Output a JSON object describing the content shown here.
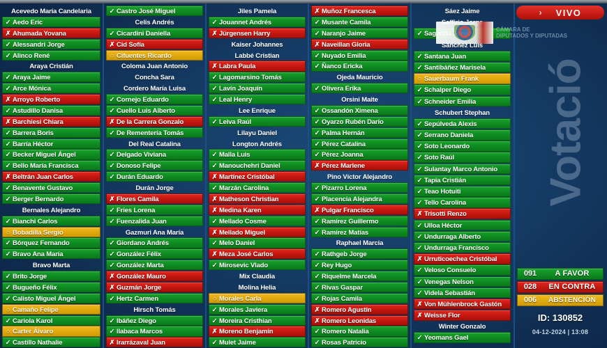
{
  "header": {
    "live_badge": {
      "chevron": "›",
      "label": "VIVO"
    },
    "logo_text_line1": "CÁMARA DE",
    "logo_text_line2": "DIPUTADOS Y DIPUTADAS"
  },
  "watermark": {
    "text": "Votació"
  },
  "results": {
    "favor": {
      "count": "091",
      "label": "A FAVOR",
      "color": "#0f8a21"
    },
    "contra": {
      "count": "028",
      "label": "EN CONTRA",
      "color": "#c41710"
    },
    "abstain": {
      "count": "006",
      "label": "ABSTENCIÓN",
      "color": "#e0a80c"
    }
  },
  "session": {
    "id_label": "ID: 130852",
    "datetime": "04-12-2024  |  13:08"
  },
  "marks": {
    "favor": "✓",
    "contra": "✗",
    "abstain": "○",
    "none": ""
  },
  "columns": [
    {
      "rows": [
        {
          "name": "Acevedo María Candelaria",
          "vote": "none"
        },
        {
          "name": "Aedo Eric",
          "vote": "favor"
        },
        {
          "name": "Ahumada Yovana",
          "vote": "contra"
        },
        {
          "name": "Alessandri Jorge",
          "vote": "favor"
        },
        {
          "name": "Alinco René",
          "vote": "favor"
        },
        {
          "name": "Araya Cristián",
          "vote": "none"
        },
        {
          "name": "Araya Jaime",
          "vote": "favor"
        },
        {
          "name": "Arce Mónica",
          "vote": "favor"
        },
        {
          "name": "Arroyo Roberto",
          "vote": "contra"
        },
        {
          "name": "Astudillo Danisa",
          "vote": "favor"
        },
        {
          "name": "Barchiesi Chiara",
          "vote": "contra"
        },
        {
          "name": "Barrera Boris",
          "vote": "favor"
        },
        {
          "name": "Barría Héctor",
          "vote": "favor"
        },
        {
          "name": "Becker Miguel Ángel",
          "vote": "favor"
        },
        {
          "name": "Bello María Francisca",
          "vote": "favor"
        },
        {
          "name": "Beltrán Juan Carlos",
          "vote": "contra"
        },
        {
          "name": "Benavente Gustavo",
          "vote": "favor"
        },
        {
          "name": "Berger Bernardo",
          "vote": "favor"
        },
        {
          "name": "Bernales Alejandro",
          "vote": "none"
        },
        {
          "name": "Bianchi Carlos",
          "vote": "favor"
        },
        {
          "name": "Bobadilla Sergio",
          "vote": "abstain"
        },
        {
          "name": "Bórquez Fernando",
          "vote": "favor"
        },
        {
          "name": "Bravo Ana María",
          "vote": "favor"
        },
        {
          "name": "Bravo Marta",
          "vote": "none"
        },
        {
          "name": "Brito Jorge",
          "vote": "favor"
        },
        {
          "name": "Bugueño Félix",
          "vote": "favor"
        },
        {
          "name": "Calisto Miguel Ángel",
          "vote": "favor"
        },
        {
          "name": "Camaño Felipe",
          "vote": "abstain"
        },
        {
          "name": "Cariola Karol",
          "vote": "favor"
        },
        {
          "name": "Carter Álvaro",
          "vote": "abstain"
        },
        {
          "name": "Castillo Nathalie",
          "vote": "favor"
        }
      ]
    },
    {
      "rows": [
        {
          "name": "Castro José Miguel",
          "vote": "favor"
        },
        {
          "name": "Celis Andrés",
          "vote": "none"
        },
        {
          "name": "Cicardini Daniella",
          "vote": "favor"
        },
        {
          "name": "Cid Sofía",
          "vote": "contra"
        },
        {
          "name": "Cifuentes Ricardo",
          "vote": "abstain"
        },
        {
          "name": "Coloma Juan Antonio",
          "vote": "none"
        },
        {
          "name": "Concha Sara",
          "vote": "none"
        },
        {
          "name": "Cordero María Luisa",
          "vote": "none"
        },
        {
          "name": "Cornejo Eduardo",
          "vote": "favor"
        },
        {
          "name": "Cuello Luis Alberto",
          "vote": "favor"
        },
        {
          "name": "De la Carrera Gonzalo",
          "vote": "contra"
        },
        {
          "name": "De Rementería Tomás",
          "vote": "favor"
        },
        {
          "name": "Del Real Catalina",
          "vote": "none"
        },
        {
          "name": "Delgado Viviana",
          "vote": "favor"
        },
        {
          "name": "Donoso Felipe",
          "vote": "favor"
        },
        {
          "name": "Durán Eduardo",
          "vote": "favor"
        },
        {
          "name": "Durán Jorge",
          "vote": "none"
        },
        {
          "name": "Flores Camila",
          "vote": "contra"
        },
        {
          "name": "Fries Lorena",
          "vote": "favor"
        },
        {
          "name": "Fuenzalida Juan",
          "vote": "favor"
        },
        {
          "name": "Gazmuri Ana María",
          "vote": "none"
        },
        {
          "name": "Giordano Andrés",
          "vote": "favor"
        },
        {
          "name": "González Félix",
          "vote": "favor"
        },
        {
          "name": "González Marta",
          "vote": "favor"
        },
        {
          "name": "González Mauro",
          "vote": "contra"
        },
        {
          "name": "Guzmán Jorge",
          "vote": "contra"
        },
        {
          "name": "Hertz Carmen",
          "vote": "favor"
        },
        {
          "name": "Hirsch Tomás",
          "vote": "none"
        },
        {
          "name": "Ibáñez Diego",
          "vote": "favor"
        },
        {
          "name": "Ilabaca Marcos",
          "vote": "favor"
        },
        {
          "name": "Irarrázaval Juan",
          "vote": "contra"
        }
      ]
    },
    {
      "rows": [
        {
          "name": "Jiles Pamela",
          "vote": "none"
        },
        {
          "name": "Jouannet Andrés",
          "vote": "favor"
        },
        {
          "name": "Jürgensen Harry",
          "vote": "contra"
        },
        {
          "name": "Kaiser Johannes",
          "vote": "none"
        },
        {
          "name": "Labbé Cristian",
          "vote": "none"
        },
        {
          "name": "Labra Paula",
          "vote": "contra"
        },
        {
          "name": "Lagomarsino Tomás",
          "vote": "favor"
        },
        {
          "name": "Lavín Joaquín",
          "vote": "favor"
        },
        {
          "name": "Leal Henry",
          "vote": "favor"
        },
        {
          "name": "Lee Enrique",
          "vote": "none"
        },
        {
          "name": "Leiva Raúl",
          "vote": "favor"
        },
        {
          "name": "Lilayu Daniel",
          "vote": "none"
        },
        {
          "name": "Longton Andrés",
          "vote": "none"
        },
        {
          "name": "Malla Luis",
          "vote": "favor"
        },
        {
          "name": "Manouchehri Daniel",
          "vote": "favor"
        },
        {
          "name": "Martínez Cristóbal",
          "vote": "contra"
        },
        {
          "name": "Marzán Carolina",
          "vote": "favor"
        },
        {
          "name": "Matheson Christian",
          "vote": "contra"
        },
        {
          "name": "Medina Karen",
          "vote": "contra"
        },
        {
          "name": "Mellado Cosme",
          "vote": "favor"
        },
        {
          "name": "Mellado Miguel",
          "vote": "contra"
        },
        {
          "name": "Melo Daniel",
          "vote": "favor"
        },
        {
          "name": "Meza José Carlos",
          "vote": "contra"
        },
        {
          "name": "Mirosevic Vlado",
          "vote": "favor"
        },
        {
          "name": "Mix Claudia",
          "vote": "none"
        },
        {
          "name": "Molina Helia",
          "vote": "none"
        },
        {
          "name": "Morales Carla",
          "vote": "abstain"
        },
        {
          "name": "Morales Javiera",
          "vote": "favor"
        },
        {
          "name": "Moreira Cristhian",
          "vote": "favor"
        },
        {
          "name": "Moreno Benjamín",
          "vote": "contra"
        },
        {
          "name": "Mulet Jaime",
          "vote": "favor"
        }
      ]
    },
    {
      "rows": [
        {
          "name": "Muñoz Francesca",
          "vote": "contra"
        },
        {
          "name": "Musante Camila",
          "vote": "favor"
        },
        {
          "name": "Naranjo Jaime",
          "vote": "favor"
        },
        {
          "name": "Naveillan Gloria",
          "vote": "contra"
        },
        {
          "name": "Nuyado Emilia",
          "vote": "favor"
        },
        {
          "name": "Ñanco Ericka",
          "vote": "favor"
        },
        {
          "name": "Ojeda Mauricio",
          "vote": "none"
        },
        {
          "name": "Olivera Erika",
          "vote": "favor"
        },
        {
          "name": "Orsini Maite",
          "vote": "none"
        },
        {
          "name": "Ossandón Ximena",
          "vote": "favor"
        },
        {
          "name": "Oyarzo Rubén Darío",
          "vote": "favor"
        },
        {
          "name": "Palma Hernán",
          "vote": "favor"
        },
        {
          "name": "Pérez Catalina",
          "vote": "favor"
        },
        {
          "name": "Pérez Joanna",
          "vote": "favor"
        },
        {
          "name": "Pérez Marlene",
          "vote": "contra"
        },
        {
          "name": "Pino Víctor Alejandro",
          "vote": "none"
        },
        {
          "name": "Pizarro Lorena",
          "vote": "favor"
        },
        {
          "name": "Placencia Alejandra",
          "vote": "favor"
        },
        {
          "name": "Pulgar Francisco",
          "vote": "contra"
        },
        {
          "name": "Ramírez Guillermo",
          "vote": "favor"
        },
        {
          "name": "Ramírez Matías",
          "vote": "favor"
        },
        {
          "name": "Raphael Marcia",
          "vote": "none"
        },
        {
          "name": "Rathgeb Jorge",
          "vote": "favor"
        },
        {
          "name": "Rey Hugo",
          "vote": "favor"
        },
        {
          "name": "Riquelme Marcela",
          "vote": "favor"
        },
        {
          "name": "Rivas Gaspar",
          "vote": "favor"
        },
        {
          "name": "Rojas Camila",
          "vote": "favor"
        },
        {
          "name": "Romero Agustín",
          "vote": "contra"
        },
        {
          "name": "Romero Leonidas",
          "vote": "contra"
        },
        {
          "name": "Romero Natalia",
          "vote": "favor"
        },
        {
          "name": "Rosas Patricio",
          "vote": "favor"
        }
      ]
    },
    {
      "rows": [
        {
          "name": "Sáez Jaime",
          "vote": "none"
        },
        {
          "name": "Saffirio Jorge",
          "vote": "none"
        },
        {
          "name": "Sagardia Jorge",
          "vote": "favor"
        },
        {
          "name": "Sánchez Luis",
          "vote": "none"
        },
        {
          "name": "Santana Juan",
          "vote": "favor"
        },
        {
          "name": "Santibáñez Marisela",
          "vote": "favor"
        },
        {
          "name": "Sauerbaum Frank",
          "vote": "abstain"
        },
        {
          "name": "Schalper Diego",
          "vote": "favor"
        },
        {
          "name": "Schneider Emilia",
          "vote": "favor"
        },
        {
          "name": "Schubert Stephan",
          "vote": "none"
        },
        {
          "name": "Sepúlveda Alexis",
          "vote": "favor"
        },
        {
          "name": "Serrano Daniela",
          "vote": "favor"
        },
        {
          "name": "Soto Leonardo",
          "vote": "favor"
        },
        {
          "name": "Soto Raúl",
          "vote": "favor"
        },
        {
          "name": "Sulantay Marco Antonio",
          "vote": "favor"
        },
        {
          "name": "Tapia Cristián",
          "vote": "favor"
        },
        {
          "name": "Teao Hotuiti",
          "vote": "favor"
        },
        {
          "name": "Tello Carolina",
          "vote": "favor"
        },
        {
          "name": "Trisotti Renzo",
          "vote": "contra"
        },
        {
          "name": "Ulloa Héctor",
          "vote": "favor"
        },
        {
          "name": "Undurraga Alberto",
          "vote": "favor"
        },
        {
          "name": "Undurraga Francisco",
          "vote": "favor"
        },
        {
          "name": "Urruticoechea Cristóbal",
          "vote": "contra"
        },
        {
          "name": "Veloso Consuelo",
          "vote": "favor"
        },
        {
          "name": "Venegas Nelson",
          "vote": "favor"
        },
        {
          "name": "Videla Sebastián",
          "vote": "favor"
        },
        {
          "name": "Von Mühlenbrock Gastón",
          "vote": "contra"
        },
        {
          "name": "Weisse Flor",
          "vote": "contra"
        },
        {
          "name": "Winter Gonzalo",
          "vote": "none"
        },
        {
          "name": "Yeomans Gael",
          "vote": "favor"
        }
      ]
    }
  ]
}
